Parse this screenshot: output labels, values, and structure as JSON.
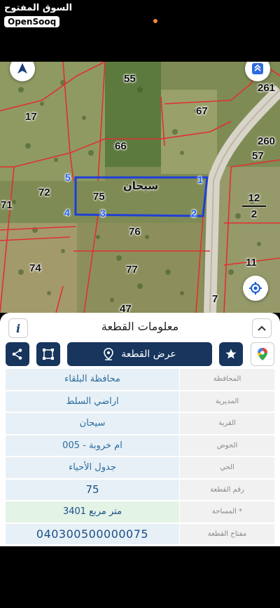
{
  "brand": {
    "arabic": "السوق المفتوح",
    "latin": "OpenSooq"
  },
  "map": {
    "parcel_numbers": [
      "55",
      "261",
      "17",
      "67",
      "66",
      "260",
      "57",
      "72",
      "75",
      "71",
      "76",
      "74",
      "77",
      "11",
      "47",
      "7"
    ],
    "fraction": {
      "top": "12",
      "bottom": "2"
    },
    "selected_parcel_name": "سيحان",
    "vertices": [
      "1",
      "2",
      "3",
      "4",
      "5"
    ],
    "compass_icon": "navigation-arrow-icon",
    "layers_icon": "map-layers-icon",
    "locate_icon": "crosshair-locate-icon",
    "highlight_color": "#1f3fd6",
    "boundary_color": "#e03030"
  },
  "sheet": {
    "title": "معلومات القطعة",
    "info_label": "i",
    "show_parcel_button": "عرض القطعة"
  },
  "rows": [
    {
      "key": "المحافظة",
      "value": "محافظة البلقاء"
    },
    {
      "key": "المديرية",
      "value": "اراضي السلط"
    },
    {
      "key": "القرية",
      "value": "سيحان"
    },
    {
      "key": "الحوض",
      "value": "ام خروبة - 005"
    },
    {
      "key": "الحي",
      "value": "جدول الأحياء"
    },
    {
      "key": "رقم القطعة",
      "value": "75"
    },
    {
      "key": "المساحة *",
      "value": "3401  متر مربع"
    },
    {
      "key": "مفتاح القطعة",
      "value": "040300500000075"
    }
  ],
  "colors": {
    "primary": "#17355d",
    "value_text": "#2a6ca0",
    "value_bg": "#e7f0f6",
    "area_bg": "#e3f3e6"
  }
}
